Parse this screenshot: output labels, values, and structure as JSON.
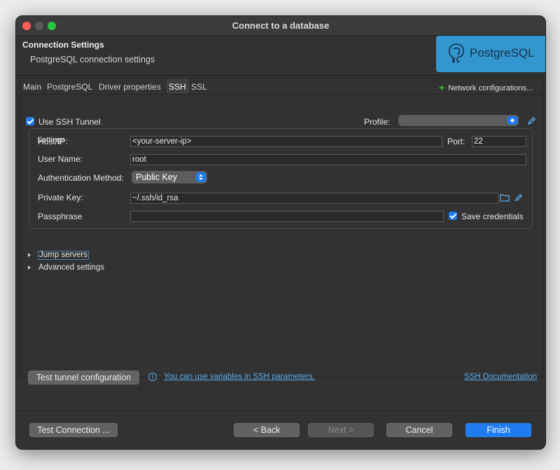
{
  "window": {
    "title": "Connect to a database"
  },
  "header": {
    "title": "Connection Settings",
    "subtitle": "PostgreSQL connection settings",
    "logo_text": "PostgreSQL"
  },
  "tabs": [
    {
      "label": "Main"
    },
    {
      "label": "PostgreSQL"
    },
    {
      "label": "Driver properties"
    },
    {
      "label": "SSH"
    },
    {
      "label": "SSL"
    }
  ],
  "active_tab": "SSH",
  "network_configurations": "Network configurations...",
  "ssh": {
    "use_tunnel_label": "Use SSH Tunnel",
    "use_tunnel_checked": true,
    "profile_label": "Profile:",
    "profile_value": "",
    "settings_label": "Settings",
    "host_label": "Host/IP:",
    "host_value": "<your-server-ip>",
    "port_label": "Port:",
    "port_value": "22",
    "user_label": "User Name:",
    "user_value": "root",
    "auth_label": "Authentication Method:",
    "auth_value": "Public Key",
    "key_label": "Private Key:",
    "key_value": "~/.ssh/id_rsa",
    "pass_label": "Passphrase",
    "pass_value": "",
    "save_credentials_label": "Save credentials",
    "save_credentials_checked": true,
    "jump_servers": "Jump servers",
    "advanced_settings": "Advanced settings",
    "test_tunnel": "Test tunnel configuration",
    "variables_link": "You can use variables in SSH parameters.",
    "docs_link": "SSH Documentation"
  },
  "footer": {
    "test_connection": "Test Connection ...",
    "back": "< Back",
    "next": "Next >",
    "cancel": "Cancel",
    "finish": "Finish"
  },
  "colors": {
    "accent": "#1f7cf0",
    "link": "#59aef0",
    "logo_bg": "#3396cf"
  }
}
